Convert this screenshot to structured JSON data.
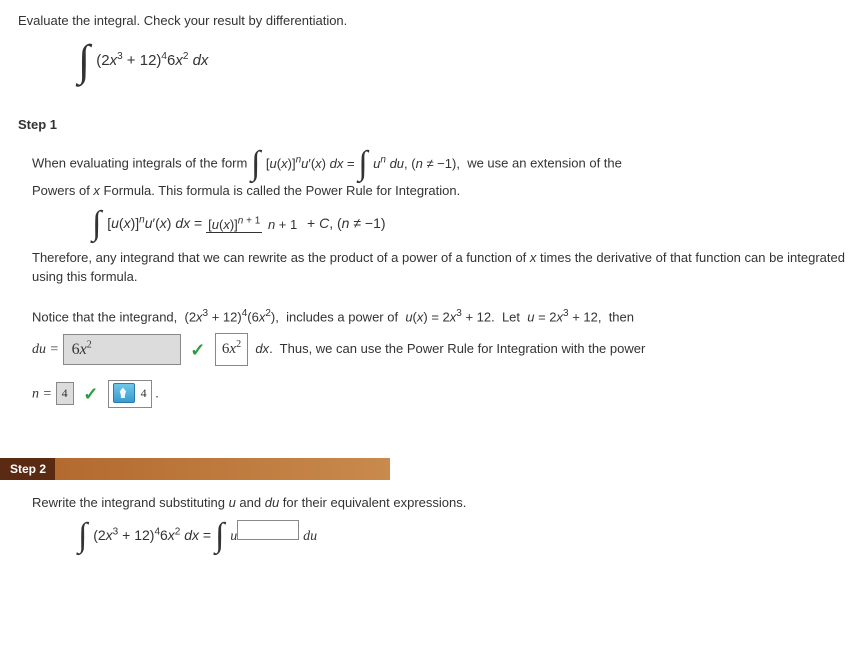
{
  "problem": {
    "instruction": "Evaluate the integral. Check your result by differentiation.",
    "integral_html": "(2<i>x</i><sup>3</sup> + 12)<sup>4</sup>6<i>x</i><sup>2</sup> <i>dx</i>"
  },
  "step1": {
    "header": "Step 1",
    "p1_a": "When evaluating integrals of the form",
    "inline_form_lhs": "[<i>u</i>(<i>x</i>)]<sup><i>n</i></sup><i>u</i>&#8242;(<i>x</i>) <i>dx</i> =",
    "inline_form_rhs": "<i>u</i><sup><i>n</i></sup> <i>du</i>, (<i>n</i> &ne; &minus;1),",
    "p1_b": "we use an extension of the",
    "p2": "Powers of <i>x</i> Formula. This formula is called the Power Rule for Integration.",
    "power_rule": {
      "lhs": "[<i>u</i>(<i>x</i>)]<sup><i>n</i></sup><i>u</i>&#8242;(<i>x</i>) <i>dx</i> =",
      "frac_num": "[<i>u</i>(<i>x</i>)]<sup><i>n</i> + 1</sup>",
      "frac_den": "<i>n</i> + 1",
      "tail": "+ <i>C</i>, (<i>n</i> &ne; &minus;1)"
    },
    "p3": "Therefore, any integrand that we can rewrite as the product of a power of a function of <i>x</i> times the derivative of that function can be integrated using this formula.",
    "p4": "Notice that the integrand, &nbsp;(2<i>x</i><sup>3</sup> + 12)<sup>4</sup>(6<i>x</i><sup>2</sup>), &nbsp;includes a power of &nbsp;<i>u</i>(<i>x</i>) = 2<i>x</i><sup>3</sup> + 12. &nbsp;Let &nbsp;<i>u</i> = 2<i>x</i><sup>3</sup> + 12, &nbsp;then",
    "du_label": "<i>du</i> =",
    "du_entered": "6<i>x</i><sup>2</sup>",
    "du_correct": "6<i>x</i><sup>2</sup>",
    "p5_after": "<i>dx</i>.&nbsp; Thus, we can use the Power Rule for Integration with the power",
    "n_label": "<i>n</i> =",
    "n_entered": "4",
    "n_hint": "4",
    "period": "."
  },
  "step2": {
    "header": "Step 2",
    "instruction": "Rewrite the integrand substituting <i>u</i> and <i>du</i> for their equivalent expressions.",
    "lhs_integral": "(2<i>x</i><sup>3</sup> + 12)<sup>4</sup>6<i>x</i><sup>2</sup> <i>dx</i> =",
    "u_symbol": "u",
    "du_symbol": "du"
  },
  "chart_data": null
}
